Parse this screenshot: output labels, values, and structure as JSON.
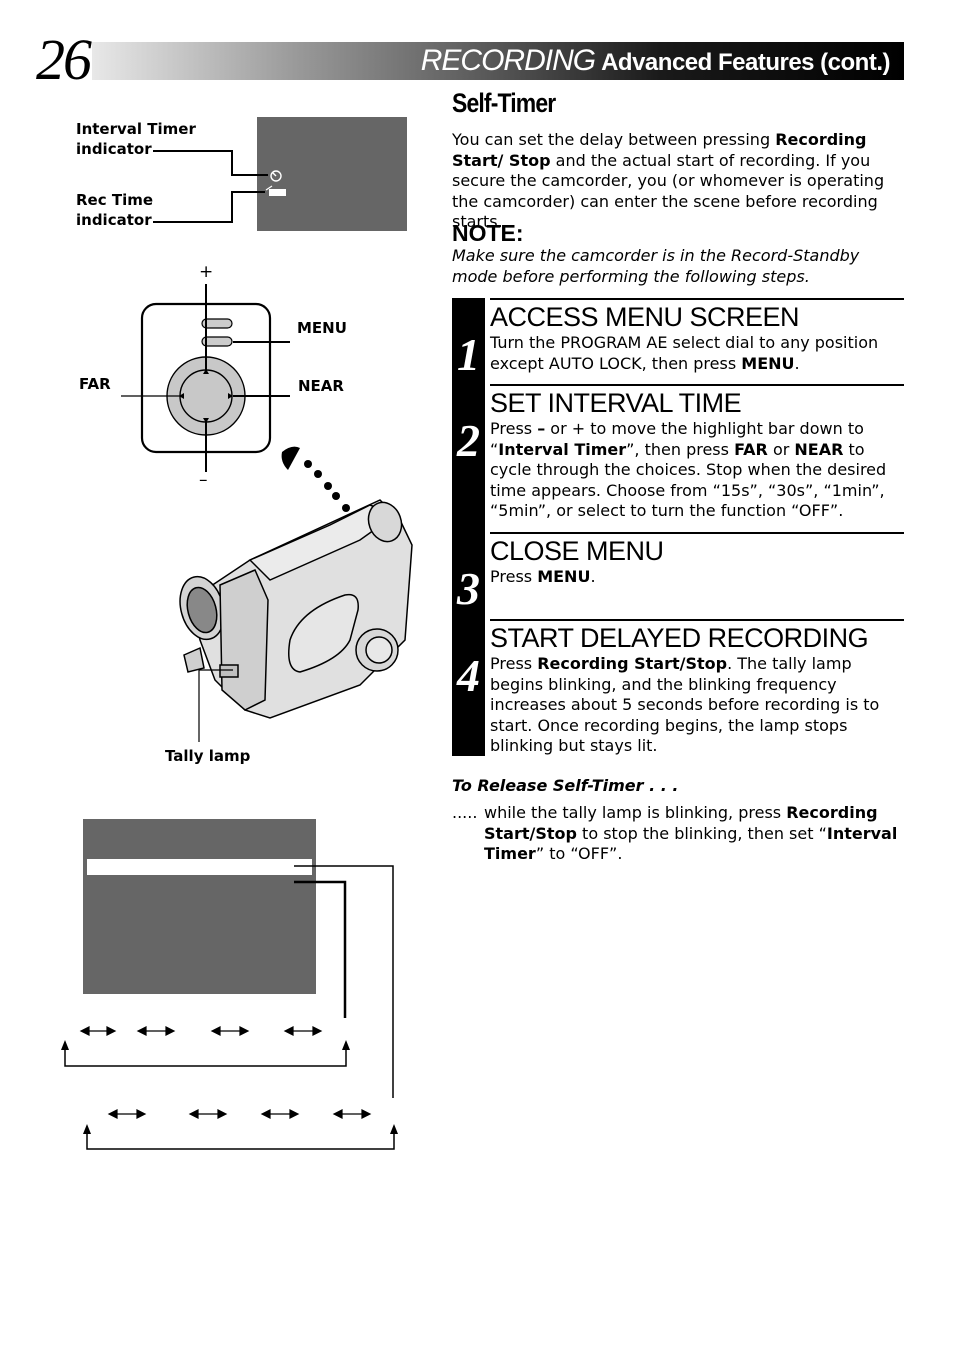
{
  "header": {
    "page_number": "26",
    "title_main": "RECORDING",
    "title_sub": "Advanced Features (cont.)"
  },
  "left": {
    "indicator_diagram": {
      "interval_timer_label": [
        "Interval Timer",
        "indicator"
      ],
      "rec_time_label": [
        "Rec Time",
        "indicator"
      ]
    },
    "control_diagram": {
      "plus": "+",
      "minus": "–",
      "menu": "MENU",
      "far": "FAR",
      "near": "NEAR"
    },
    "camcorder": {
      "tally_lamp_label": "Tally lamp"
    }
  },
  "right": {
    "section_title": "Self-Timer",
    "intro": {
      "p1": "You can set the delay between pressing ",
      "b1": "Recording Start/ Stop",
      "p2": " and the actual start of recording. If you secure the camcorder, you (or whomever is operating the camcorder) can enter the scene before recording starts."
    },
    "note": {
      "heading": "NOTE:",
      "text": "Make sure the camcorder is in the Record-Standby mode before performing the following steps."
    },
    "steps": [
      {
        "number": "1",
        "title": "ACCESS MENU SCREEN",
        "t1": "Turn the PROGRAM AE select dial to any position except AUTO LOCK, then press ",
        "b1": "MENU",
        "t2": "."
      },
      {
        "number": "2",
        "title": "SET INTERVAL TIME",
        "t1": "Press ",
        "b1": "–",
        "t2": " or + to move the highlight bar down to “",
        "b2": "Interval Timer",
        "t3": "”, then press ",
        "b3": "FAR",
        "t4": " or ",
        "b4": "NEAR",
        "t5": " to cycle through the choices. Stop when the desired time appears. Choose from “15s”, “30s”, “1min”, “5min”, or select to turn the function “OFF”."
      },
      {
        "number": "3",
        "title": "CLOSE MENU",
        "t1": "Press ",
        "b1": "MENU",
        "t2": "."
      },
      {
        "number": "4",
        "title": "START DELAYED RECORDING",
        "t1": "Press ",
        "b1": "Recording Start/Stop",
        "t2": ". The tally lamp begins blinking, and the blinking frequency increases about 5 seconds before recording is to start. Once recording begins, the lamp stops blinking but stays lit."
      }
    ],
    "release": {
      "heading": "To Release Self-Timer . . .",
      "dots": ".....",
      "t1": "while the tally lamp is blinking, press ",
      "b1": "Recording Start/Stop",
      "t2": " to stop the blinking, then set “",
      "b2": "Interval Timer",
      "t3": "” to “OFF”."
    }
  }
}
